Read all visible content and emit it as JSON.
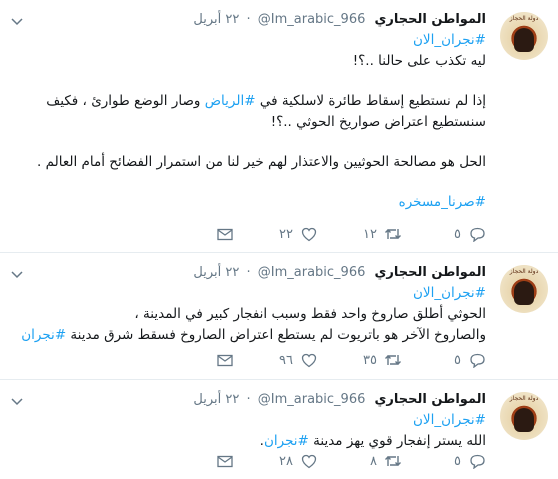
{
  "tweets": [
    {
      "author": "المواطن الحجاري",
      "handle": "@Im_arabic_966",
      "date": "٢٢ أبريل",
      "lines": [
        {
          "parts": [
            {
              "t": "#نجران_الان",
              "tag": true
            }
          ]
        },
        {
          "parts": [
            {
              "t": "ليه تكذب على حالنا ..؟!",
              "tag": false
            }
          ]
        },
        {
          "gap": true
        },
        {
          "parts": [
            {
              "t": "إذا لم نستطيع إسقاط طائرة لاسلكية في ",
              "tag": false
            },
            {
              "t": "#الرياض",
              "tag": true
            },
            {
              "t": " وصار الوضع طوارئ ، فكيف",
              "tag": false
            }
          ]
        },
        {
          "parts": [
            {
              "t": "سنستطيع اعتراض صواريخ الحوثي ..؟!",
              "tag": false
            }
          ]
        },
        {
          "gap": true
        },
        {
          "parts": [
            {
              "t": "الحل هو مصالحة الحوثيين والاعتذار لهم خير لنا من استمرار الفضائح أمام العالم .",
              "tag": false
            }
          ]
        },
        {
          "gap": true
        },
        {
          "parts": [
            {
              "t": "#صرنا_مسخره",
              "tag": true
            }
          ]
        }
      ],
      "replies": "٥",
      "retweets": "١٢",
      "likes": "٢٢"
    },
    {
      "author": "المواطن الحجاري",
      "handle": "@Im_arabic_966",
      "date": "٢٢ أبريل",
      "lines": [
        {
          "parts": [
            {
              "t": "#نجران_الان",
              "tag": true
            }
          ]
        },
        {
          "parts": [
            {
              "t": "الحوثي أطلق صاروخ واحد فقط وسبب انفجار كبير في المدينة ،",
              "tag": false
            }
          ]
        },
        {
          "parts": [
            {
              "t": "والصاروخ الآخر هو باتريوت لم يستطع اعتراض الصاروخ فسقط شرق مدينة ",
              "tag": false
            },
            {
              "t": "#نجران",
              "tag": true
            }
          ]
        }
      ],
      "replies": "٥",
      "retweets": "٣٥",
      "likes": "٩٦"
    },
    {
      "author": "المواطن الحجاري",
      "handle": "@Im_arabic_966",
      "date": "٢٢ أبريل",
      "lines": [
        {
          "parts": [
            {
              "t": "#نجران_الان",
              "tag": true
            }
          ]
        },
        {
          "parts": [
            {
              "t": "الله يستر إنفجار قوي يهز مدينة ",
              "tag": false
            },
            {
              "t": "#نجران",
              "tag": true
            },
            {
              "t": ".",
              "tag": false
            }
          ]
        }
      ],
      "replies": "٥",
      "retweets": "٨",
      "likes": "٢٨"
    }
  ],
  "dot": "·",
  "avatar_caption": "دولة الحجاز",
  "colors": {
    "link": "#1da1f2",
    "muted": "#657786",
    "text": "#14171a",
    "divider": "#e6ecf0"
  },
  "icons": [
    "reply-icon",
    "retweet-icon",
    "like-icon",
    "direct-message-icon",
    "chevron-down-icon"
  ]
}
